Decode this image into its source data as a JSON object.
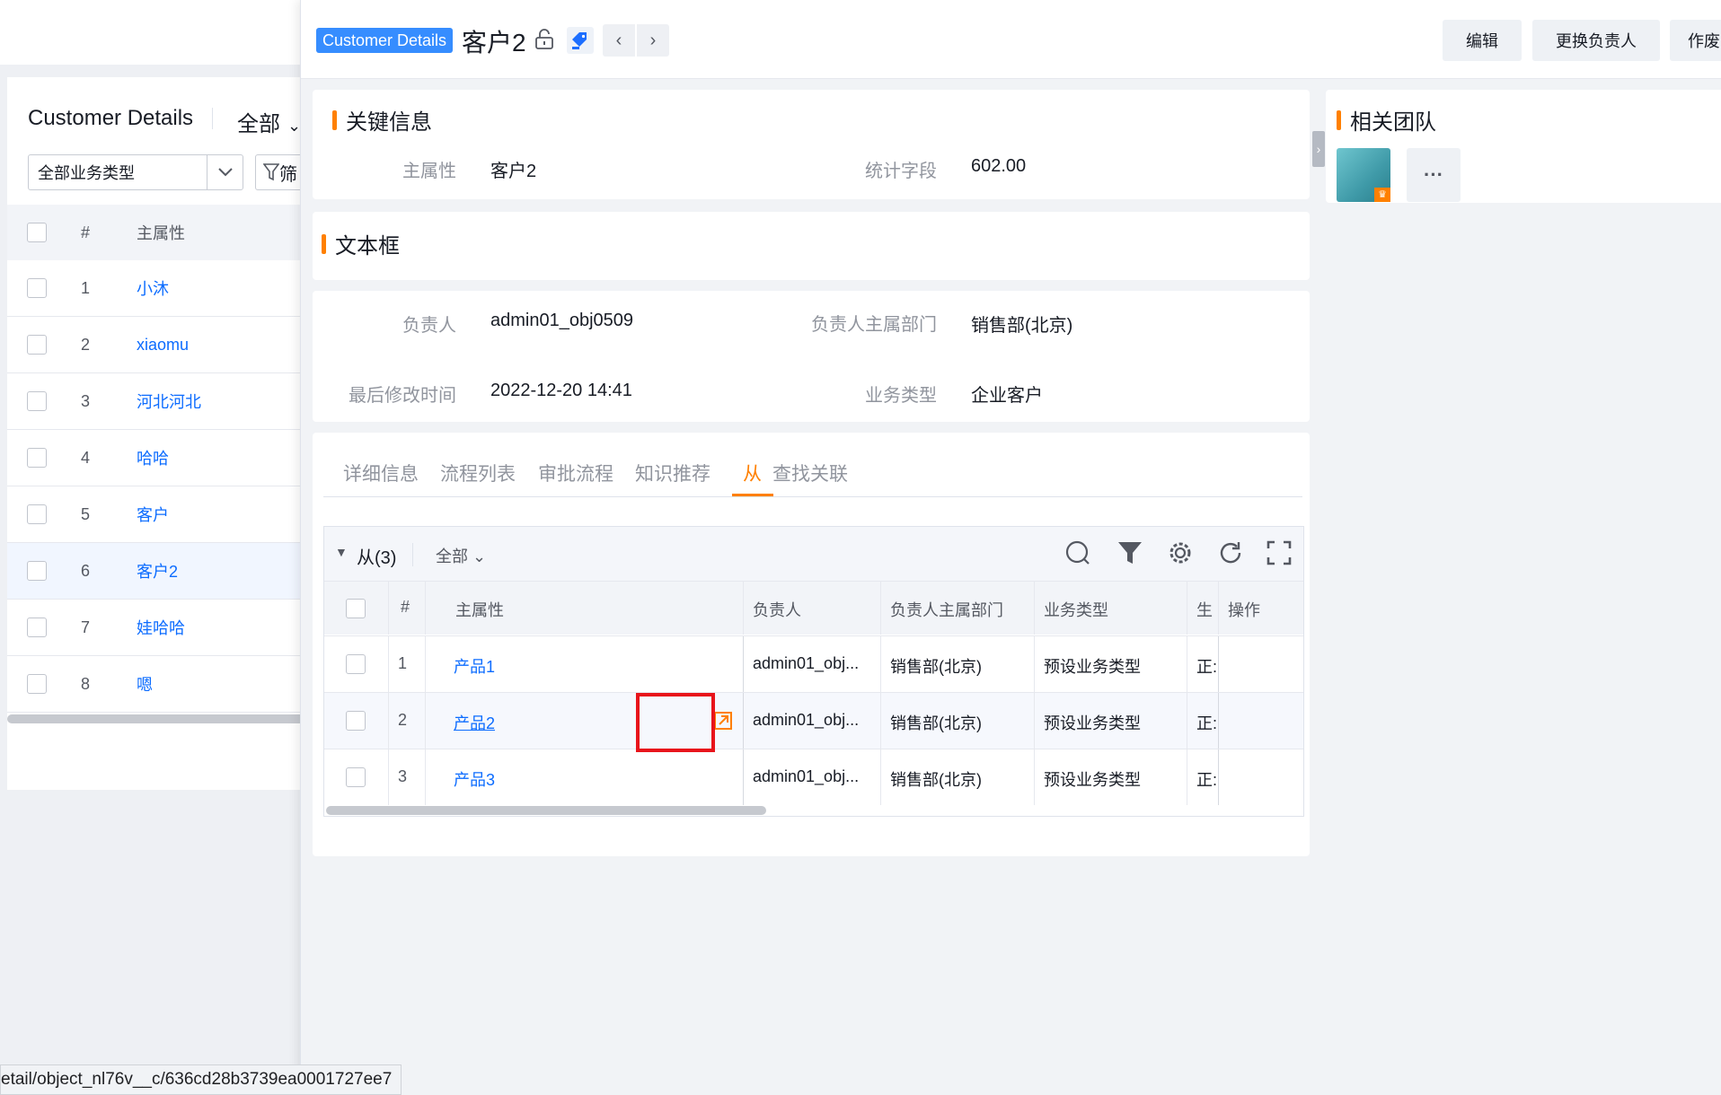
{
  "left_list": {
    "title": "Customer Details",
    "scope": "全部",
    "type_select": "全部业务类型",
    "filter_label": "筛",
    "header": {
      "num": "#",
      "col": "主属性"
    },
    "rows": [
      {
        "num": "1",
        "name": "小沐"
      },
      {
        "num": "2",
        "name": "xiaomu"
      },
      {
        "num": "3",
        "name": "河北河北"
      },
      {
        "num": "4",
        "name": "哈哈"
      },
      {
        "num": "5",
        "name": "客户"
      },
      {
        "num": "6",
        "name": "客户2"
      },
      {
        "num": "7",
        "name": "娃哈哈"
      },
      {
        "num": "8",
        "name": "嗯"
      }
    ],
    "selected_index": 5
  },
  "detail": {
    "object_badge": "Customer Details",
    "record_title": "客户2",
    "buttons": {
      "edit": "编辑",
      "change_owner": "更换负责人",
      "void": "作废"
    },
    "key_info": {
      "title": "关键信息",
      "fields": [
        {
          "label": "主属性",
          "value": "客户2"
        },
        {
          "label": "统计字段",
          "value": "602.00"
        }
      ]
    },
    "text_box": {
      "title": "文本框"
    },
    "owner_info": {
      "fields": [
        {
          "label": "负责人",
          "value": "admin01_obj0509"
        },
        {
          "label": "负责人主属部门",
          "value": "销售部(北京)"
        },
        {
          "label": "最后修改时间",
          "value": "2022-12-20 14:41"
        },
        {
          "label": "业务类型",
          "value": "企业客户"
        }
      ]
    },
    "team": {
      "title": "相关团队",
      "more": "···"
    },
    "tabs": [
      {
        "label": "详细信息"
      },
      {
        "label": "流程列表"
      },
      {
        "label": "审批流程"
      },
      {
        "label": "知识推荐"
      },
      {
        "label": "从"
      },
      {
        "label": "查找关联"
      }
    ],
    "active_tab": 4,
    "sub_table": {
      "title": "从(3)",
      "scope": "全部",
      "columns": [
        "#",
        "主属性",
        "负责人",
        "负责人主属部门",
        "业务类型",
        "生",
        "操作"
      ],
      "rows": [
        {
          "num": "1",
          "name": "产品1",
          "owner": "admin01_obj...",
          "dept": "销售部(北京)",
          "type": "预设业务类型",
          "status": "正:"
        },
        {
          "num": "2",
          "name": "产品2",
          "owner": "admin01_obj...",
          "dept": "销售部(北京)",
          "type": "预设业务类型",
          "status": "正:"
        },
        {
          "num": "3",
          "name": "产品3",
          "owner": "admin01_obj...",
          "dept": "销售部(北京)",
          "type": "预设业务类型",
          "status": "正:"
        }
      ]
    }
  },
  "status_url": "etail/object_nl76v__c/636cd28b3739ea0001727ee7",
  "colors": {
    "accent": "#ff8000",
    "link": "#0c6cff",
    "badge": "#368dff",
    "highlight": "#e8141b"
  }
}
